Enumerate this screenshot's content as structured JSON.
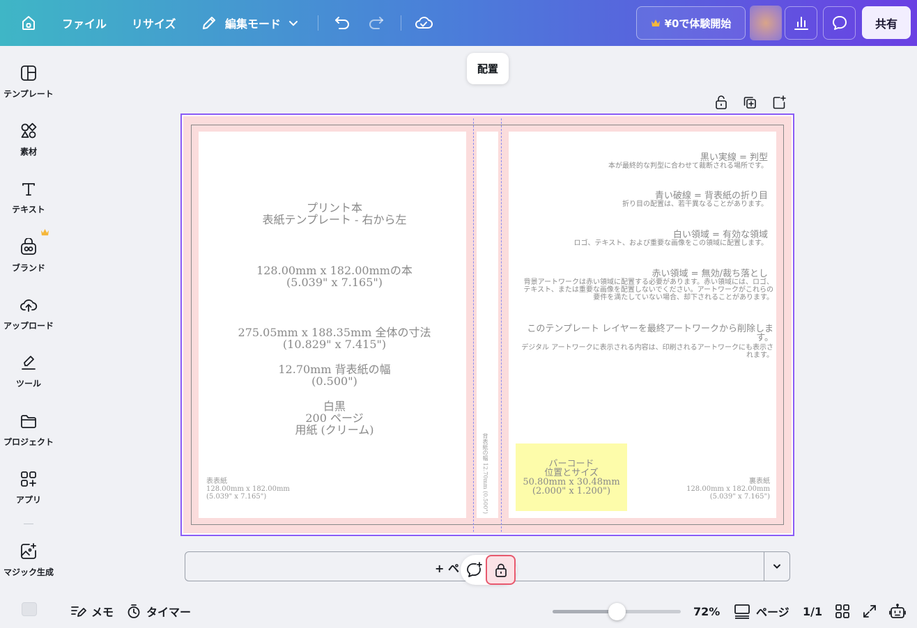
{
  "topbar": {
    "file_label": "ファイル",
    "resize_label": "リサイズ",
    "edit_mode_label": "編集モード",
    "trial_label": "¥0で体験開始",
    "share_label": "共有",
    "gradient": [
      "#3fb6c6",
      "#4a7fd9",
      "#6a40e3"
    ]
  },
  "sidebar": {
    "items": [
      {
        "label": "テンプレート",
        "icon": "template-icon"
      },
      {
        "label": "素材",
        "icon": "elements-icon"
      },
      {
        "label": "テキスト",
        "icon": "text-icon"
      },
      {
        "label": "ブランド",
        "icon": "brand-icon"
      },
      {
        "label": "アップロード",
        "icon": "upload-icon"
      },
      {
        "label": "ツール",
        "icon": "tools-icon"
      },
      {
        "label": "プロジェクト",
        "icon": "folder-icon"
      },
      {
        "label": "アプリ",
        "icon": "apps-icon"
      },
      {
        "label": "マジック生成",
        "icon": "magic-icon"
      }
    ]
  },
  "canvas": {
    "tooltip": "配置",
    "left_panel": {
      "title_line1": "プリント本",
      "title_line2": "表紙テンプレート - 右から左",
      "size_line1": "128.00mm x 182.00mmの本",
      "size_line2": "(5.039\" x 7.165\")",
      "total_line1": "275.05mm x 188.35mm 全体の寸法",
      "total_line2": "(10.829\" x 7.415\")",
      "spine_line1": "12.70mm 背表紙の幅",
      "spine_line2": "(0.500\")",
      "paper_line1": "白黒",
      "paper_line2": "200 ページ",
      "paper_line3": "用紙 (クリーム)",
      "corner_line1": "表表紙",
      "corner_line2": "128.00mm x 182.00mm",
      "corner_line3": "(5.039\" x 7.165\")"
    },
    "spine_text": "背表紙の幅 12.70mm (0.500\")",
    "right_panel": {
      "black_h": "黒い実線 = 判型",
      "black_b": "本が最終的な判型に合わせて裁断される場所です。",
      "blue_h": "青い破線 = 背表紙の折り目",
      "blue_b": "折り目の配置は、若干異なることがあります。",
      "white_h": "白い領域 = 有効な領域",
      "white_b": "ロゴ、テキスト、および重要な画像をこの領域に配置します。",
      "red_h": "赤い領域 = 無効/裁ち落とし",
      "red_b": "背景アートワークは赤い領域に配置する必要があります。赤い領域には、ロゴ、テキスト、または重要な画像を配置しないでください。アートワークがこれらの要件を満たしていない場合、却下されることがあります。",
      "remove_h": "このテンプレート レイヤーを最終アートワークから削除します。",
      "remove_b": "デジタル アートワークに表示される内容は、印刷されるアートワークにも表示されます。",
      "barcode_line1": "バーコード",
      "barcode_line2": "位置とサイズ",
      "barcode_line3": "50.80mm x 30.48mm",
      "barcode_line4": "(2.000\" x 1.200\")",
      "corner_line1": "裏表紙",
      "corner_line2": "128.00mm x 182.00mm",
      "corner_line3": "(5.039\" x 7.165\")"
    },
    "add_page_label": "+ ペ"
  },
  "bottombar": {
    "notes_label": "メモ",
    "timer_label": "タイマー",
    "zoom_label": "72%",
    "zoom_fraction": 0.5,
    "pages_label": "ページ",
    "page_count": "1/1"
  }
}
